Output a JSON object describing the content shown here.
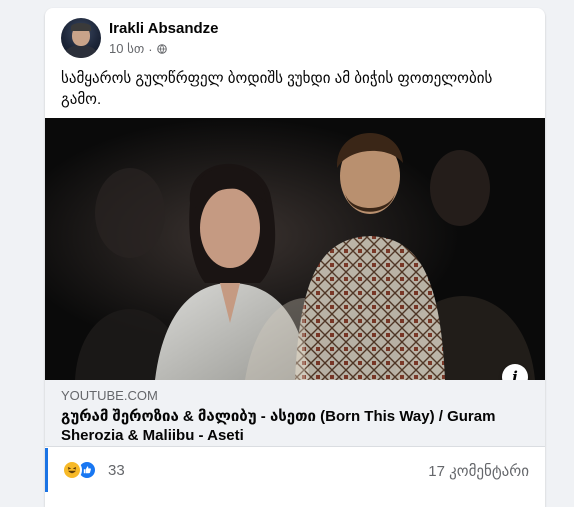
{
  "post": {
    "author_name": "Irakli Absandze",
    "time": "10 სთ",
    "separator": "·",
    "text": "სამყაროს გულწრფელ ბოდიშს ვუხდი ამ ბიჭის ფოთელობის გამო."
  },
  "link_preview": {
    "domain": "YOUTUBE.COM",
    "title": "გურამ შეროზია & მალიბუ - ასეთი (Born This Way) / Guram Sherozia & Maliibu - Aseti",
    "info_glyph": "i"
  },
  "engagement": {
    "reaction_count": "33",
    "comments_label": "17 კომენტარი"
  },
  "icons": {
    "avatar": "avatar-photo",
    "privacy": "globe-icon",
    "info": "info-icon",
    "reaction_haha": "haha-reaction-icon",
    "reaction_like": "like-reaction-icon"
  },
  "colors": {
    "background": "#f0f2f5",
    "card": "#ffffff",
    "text_primary": "#050505",
    "text_secondary": "#65676b",
    "accent_blue": "#1877f2",
    "haha_yellow": "#f7b928"
  }
}
